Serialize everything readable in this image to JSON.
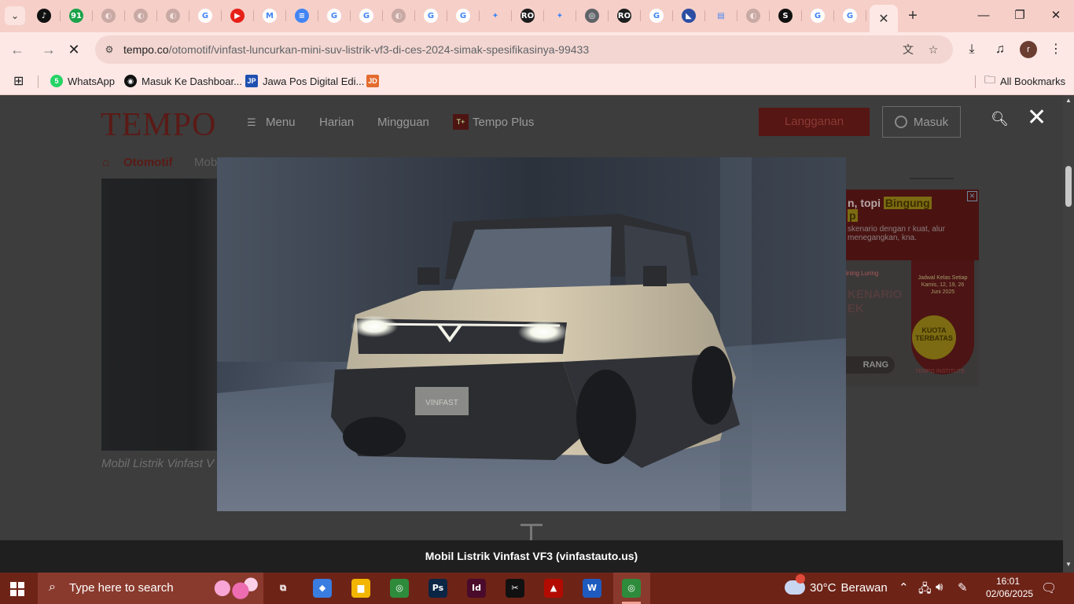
{
  "browser": {
    "tabs": [
      {
        "label": "TikTok",
        "icon": "tiktok-icon",
        "color": "#111111",
        "glyph": "♪"
      },
      {
        "label": "Tab 2",
        "icon": "green-badge-icon",
        "color": "#1aa34a",
        "glyph": "91"
      },
      {
        "label": "Tab 3",
        "icon": "globe-icon",
        "color": "#c9a9a4",
        "glyph": "◐"
      },
      {
        "label": "Tab 4",
        "icon": "globe-icon",
        "color": "#c9a9a4",
        "glyph": "◐"
      },
      {
        "label": "Tab 5",
        "icon": "globe-icon",
        "color": "#c9a9a4",
        "glyph": "◐"
      },
      {
        "label": "Google",
        "icon": "google-icon",
        "color": "#ffffff",
        "glyph": "G"
      },
      {
        "label": "YouTube",
        "icon": "youtube-icon",
        "color": "#e62117",
        "glyph": "▶"
      },
      {
        "label": "Gmail",
        "icon": "gmail-icon",
        "color": "#ffffff",
        "glyph": "M"
      },
      {
        "label": "Google Docs",
        "icon": "docs-icon",
        "color": "#4285f4",
        "glyph": "≡"
      },
      {
        "label": "Google",
        "icon": "google-icon",
        "color": "#ffffff",
        "glyph": "G"
      },
      {
        "label": "Google",
        "icon": "google-icon",
        "color": "#ffffff",
        "glyph": "G"
      },
      {
        "label": "Tab 12",
        "icon": "globe-icon",
        "color": "#c9a9a4",
        "glyph": "◐"
      },
      {
        "label": "Google",
        "icon": "google-icon",
        "color": "#ffffff",
        "glyph": "G"
      },
      {
        "label": "Google",
        "icon": "google-icon",
        "color": "#ffffff",
        "glyph": "G"
      },
      {
        "label": "Tab 15",
        "icon": "app-icon",
        "color": "#f6cfc9",
        "glyph": "✦"
      },
      {
        "label": "Tab 16",
        "icon": "app-icon",
        "color": "#1c1c1c",
        "glyph": "RO"
      },
      {
        "label": "Tab 17",
        "icon": "app-icon",
        "color": "#f6cfc9",
        "glyph": "✦"
      },
      {
        "label": "Tab 18",
        "icon": "chrome-icon",
        "color": "#5f6368",
        "glyph": "◎"
      },
      {
        "label": "Tab 19",
        "icon": "app-icon",
        "color": "#1c1c1c",
        "glyph": "RO"
      },
      {
        "label": "Google",
        "icon": "google-icon",
        "color": "#ffffff",
        "glyph": "G"
      },
      {
        "label": "Tab 21",
        "icon": "app-icon",
        "color": "#2b4ea3",
        "glyph": "◣"
      },
      {
        "label": "Tab 22",
        "icon": "app-icon",
        "color": "#f6cfc9",
        "glyph": "▤"
      },
      {
        "label": "Tab 23",
        "icon": "globe-icon",
        "color": "#c9a9a4",
        "glyph": "◐"
      },
      {
        "label": "Tab 24",
        "icon": "s-icon",
        "color": "#111111",
        "glyph": "S"
      },
      {
        "label": "Google",
        "icon": "google-icon",
        "color": "#ffffff",
        "glyph": "G"
      },
      {
        "label": "Google",
        "icon": "google-icon",
        "color": "#ffffff",
        "glyph": "G"
      }
    ],
    "url_host": "tempo.co",
    "url_path": "/otomotif/vinfast-luncurkan-mini-suv-listrik-vf3-di-ces-2024-simak-spesifikasinya-99433",
    "profile_initial": "r",
    "bookmarks": [
      {
        "label": "WhatsApp",
        "color": "#25d366",
        "glyph": "5"
      },
      {
        "label": "Masuk Ke Dashboar...",
        "color": "#111111",
        "glyph": "◉"
      },
      {
        "label": "Jawa Pos Digital Edi...",
        "color": "#1f4fb0",
        "glyph": "JP"
      },
      {
        "label": "",
        "color": "#e46b2e",
        "glyph": "JD"
      }
    ],
    "all_bookmarks_label": "All Bookmarks"
  },
  "page": {
    "logo": "TEMPO",
    "nav": {
      "menu": "Menu",
      "harian": "Harian",
      "mingguan": "Mingguan",
      "tempo_plus": "Tempo Plus",
      "tempo_plus_badge": "T+"
    },
    "subscribe_label": "Langganan",
    "login_label": "Masuk",
    "breadcrumb": {
      "section": "Otomotif",
      "next": "Mob"
    },
    "background_caption": "Mobil Listrik Vinfast V",
    "ad": {
      "line1_prefix": "n, topi",
      "line1_highlight": "Bingung",
      "line1_tail": "p",
      "line2": "skenario dengan r kuat, alur menegangkan, kna.",
      "chips": "ining  Luring",
      "big": "KENARIO\nEK",
      "schedule": "Jadwal Kelas Setiap Kamis, 12, 19, 26 Juni 2025",
      "quota": "KUOTA TERBATAS",
      "button": "RANG",
      "institute": "TEMPO INSTITUTE"
    },
    "lightbox": {
      "caption": "Mobil Listrik Vinfast VF3 (vinfastauto.us)",
      "plate_text": "VINFAST"
    }
  },
  "taskbar": {
    "search_placeholder": "Type here to search",
    "apps": [
      {
        "name": "task-view-icon",
        "glyph": "⧉",
        "color": "transparent"
      },
      {
        "name": "copilot-icon",
        "glyph": "◆",
        "color": "#3a7de0"
      },
      {
        "name": "file-explorer-icon",
        "glyph": "▆",
        "color": "#f2b500"
      },
      {
        "name": "chrome-icon",
        "glyph": "◎",
        "color": "#2e8b3c"
      },
      {
        "name": "photoshop-icon",
        "glyph": "Ps",
        "color": "#0b2545"
      },
      {
        "name": "indesign-icon",
        "glyph": "Id",
        "color": "#4a0a2b"
      },
      {
        "name": "capcut-icon",
        "glyph": "✂",
        "color": "#111111"
      },
      {
        "name": "acrobat-icon",
        "glyph": "▲",
        "color": "#b30b00"
      },
      {
        "name": "word-icon",
        "glyph": "W",
        "color": "#1f5bbf"
      },
      {
        "name": "chrome-profile-icon",
        "glyph": "◎",
        "color": "#2e8b3c"
      }
    ],
    "weather_temp": "30°C",
    "weather_text": "Berawan",
    "time": "16:01",
    "date": "02/06/2025"
  }
}
